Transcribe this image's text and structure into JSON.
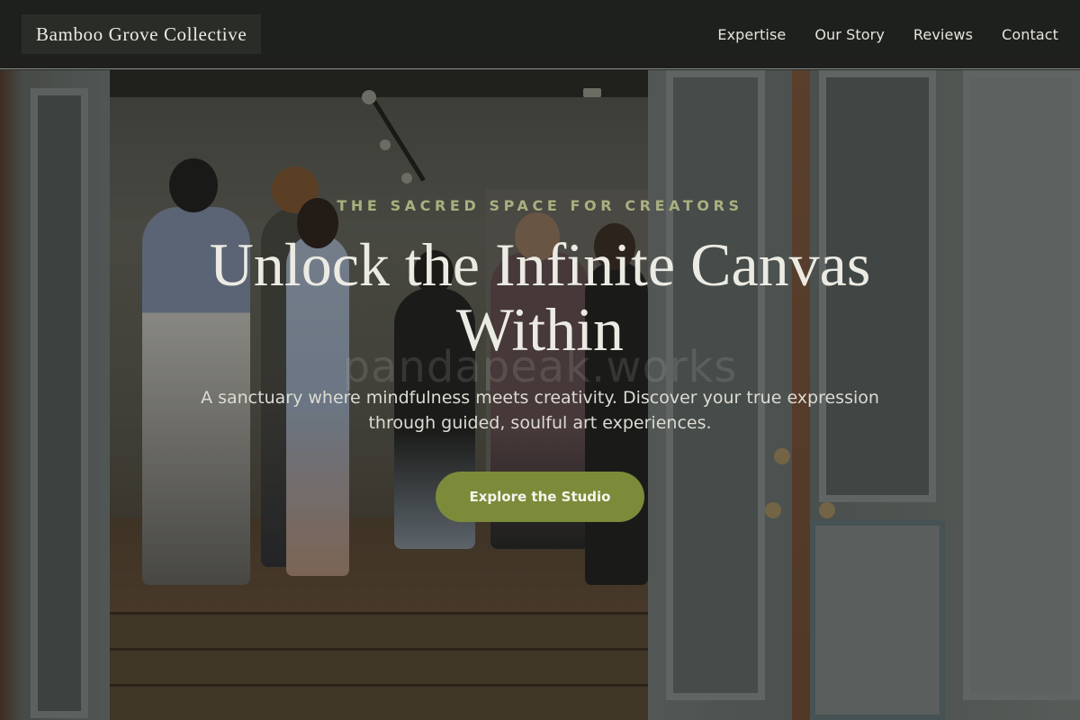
{
  "brand": {
    "name": "Bamboo Grove Collective"
  },
  "nav": {
    "items": [
      {
        "label": "Expertise"
      },
      {
        "label": "Our Story"
      },
      {
        "label": "Reviews"
      },
      {
        "label": "Contact"
      }
    ]
  },
  "hero": {
    "eyebrow": "THE SACRED SPACE FOR CREATORS",
    "headline": "Unlock the Infinite Canvas Within",
    "watermark": "pandapeak.works",
    "subtext": "A sanctuary where mindfulness meets creativity. Discover your true expression through guided, soulful art experiences.",
    "cta_label": "Explore the Studio",
    "background_image": "gallery-doorway-photo"
  },
  "colors": {
    "accent": "#7b8b3a",
    "eyebrow": "#a9b07f",
    "nav_background": "#1e201d",
    "text_light": "#ecebe3"
  }
}
